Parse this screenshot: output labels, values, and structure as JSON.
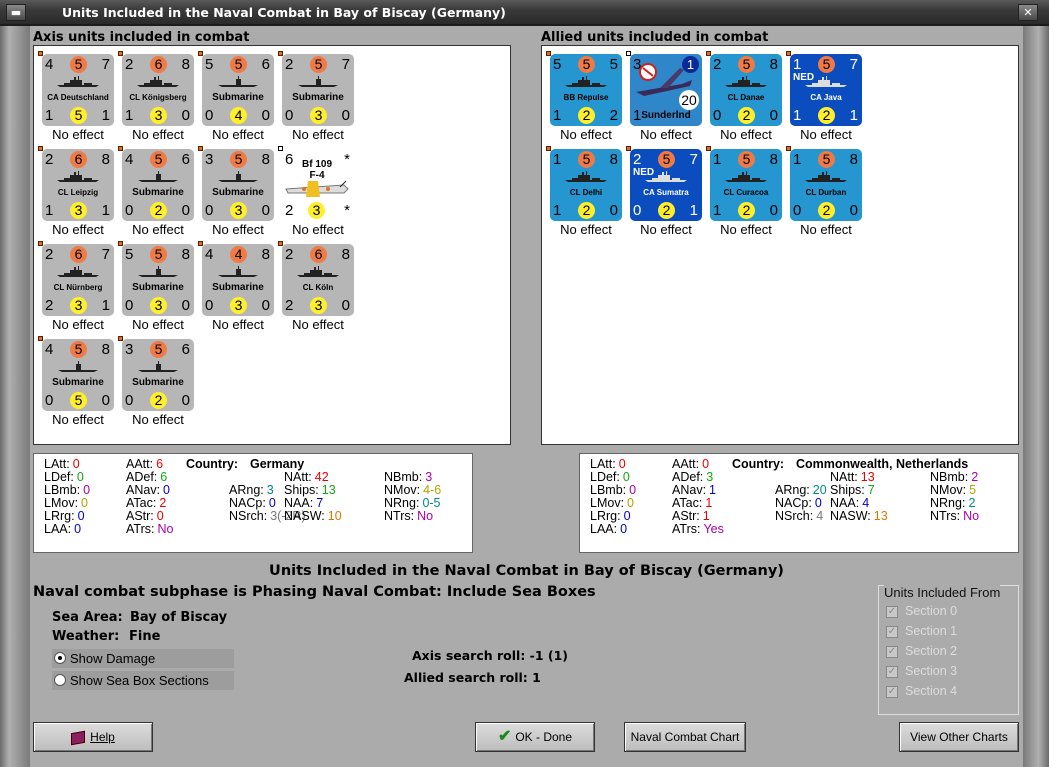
{
  "window": {
    "title": "Units Included in the Naval Combat in Bay of Biscay (Germany)"
  },
  "axis_title": "Axis units included in combat",
  "allied_title": "Allied units included in combat",
  "axis_units": [
    {
      "tl": "4",
      "tc": "5",
      "tr": "7",
      "name": "CA Deutschland",
      "bl": "1",
      "bc": "5",
      "br": "1",
      "effect": "No effect",
      "style": "grey"
    },
    {
      "tl": "2",
      "tc": "6",
      "tr": "8",
      "name": "CL Königsberg",
      "bl": "1",
      "bc": "3",
      "br": "0",
      "effect": "No effect",
      "style": "grey"
    },
    {
      "tl": "5",
      "tc": "5",
      "tr": "6",
      "name": "Submarine",
      "bl": "0",
      "bc": "4",
      "br": "0",
      "effect": "No effect",
      "style": "grey"
    },
    {
      "tl": "2",
      "tc": "5",
      "tr": "7",
      "name": "Submarine",
      "bl": "0",
      "bc": "3",
      "br": "0",
      "effect": "No effect",
      "style": "grey"
    },
    {
      "tl": "2",
      "tc": "6",
      "tr": "8",
      "name": "CL Leipzig",
      "bl": "1",
      "bc": "3",
      "br": "1",
      "effect": "No effect",
      "style": "grey"
    },
    {
      "tl": "4",
      "tc": "5",
      "tr": "6",
      "name": "Submarine",
      "bl": "0",
      "bc": "2",
      "br": "0",
      "effect": "No effect",
      "style": "grey"
    },
    {
      "tl": "3",
      "tc": "5",
      "tr": "8",
      "name": "Submarine",
      "bl": "0",
      "bc": "3",
      "br": "0",
      "effect": "No effect",
      "style": "grey"
    },
    {
      "tl": "6",
      "tc": "",
      "tr": "*",
      "name": "Bf 109 F-4",
      "bl": "2",
      "bc": "3",
      "br": "*",
      "effect": "No effect",
      "style": "white"
    },
    {
      "tl": "2",
      "tc": "6",
      "tr": "7",
      "name": "CL Nürnberg",
      "bl": "2",
      "bc": "3",
      "br": "1",
      "effect": "No effect",
      "style": "grey"
    },
    {
      "tl": "5",
      "tc": "5",
      "tr": "8",
      "name": "Submarine",
      "bl": "0",
      "bc": "3",
      "br": "0",
      "effect": "No effect",
      "style": "grey"
    },
    {
      "tl": "4",
      "tc": "4",
      "tr": "8",
      "name": "Submarine",
      "bl": "0",
      "bc": "3",
      "br": "0",
      "effect": "No effect",
      "style": "grey"
    },
    {
      "tl": "2",
      "tc": "6",
      "tr": "8",
      "name": "CL Köln",
      "bl": "2",
      "bc": "3",
      "br": "0",
      "effect": "No effect",
      "style": "grey"
    },
    {
      "tl": "4",
      "tc": "5",
      "tr": "8",
      "name": "Submarine",
      "bl": "0",
      "bc": "5",
      "br": "0",
      "effect": "No effect",
      "style": "grey"
    },
    {
      "tl": "3",
      "tc": "5",
      "tr": "6",
      "name": "Submarine",
      "bl": "0",
      "bc": "2",
      "br": "0",
      "effect": "No effect",
      "style": "grey"
    }
  ],
  "allied_units": [
    {
      "tl": "5",
      "tc": "5",
      "tr": "5",
      "name": "BB Repulse",
      "bl": "1",
      "bc": "2",
      "br": "2",
      "effect": "No effect",
      "style": "blue"
    },
    {
      "tl": "3",
      "tc": "",
      "tr": "1",
      "name": "Sunderlnd",
      "bl": "1",
      "bc": "",
      "br": "20",
      "effect": "No effect",
      "style": "plane"
    },
    {
      "tl": "2",
      "tc": "5",
      "tr": "8",
      "name": "CL Danae",
      "bl": "0",
      "bc": "2",
      "br": "0",
      "effect": "No effect",
      "style": "blue"
    },
    {
      "tl": "1",
      "tc": "5",
      "tr": "7",
      "name": "CA Java",
      "nat": "NED",
      "bl": "1",
      "bc": "2",
      "br": "1",
      "effect": "No effect",
      "style": "dblue"
    },
    {
      "tl": "1",
      "tc": "5",
      "tr": "8",
      "name": "CL Delhi",
      "bl": "1",
      "bc": "2",
      "br": "0",
      "effect": "No effect",
      "style": "blue"
    },
    {
      "tl": "2",
      "tc": "5",
      "tr": "7",
      "name": "CA Sumatra",
      "nat": "NED",
      "bl": "0",
      "bc": "2",
      "br": "1",
      "effect": "No effect",
      "style": "dblue"
    },
    {
      "tl": "1",
      "tc": "5",
      "tr": "8",
      "name": "CL Curacoa",
      "bl": "1",
      "bc": "2",
      "br": "0",
      "effect": "No effect",
      "style": "blue"
    },
    {
      "tl": "1",
      "tc": "5",
      "tr": "8",
      "name": "CL Durban",
      "bl": "0",
      "bc": "2",
      "br": "0",
      "effect": "No effect",
      "style": "blue"
    }
  ],
  "axis_stats": {
    "country_label": "Country:",
    "country": "Germany",
    "items": [
      {
        "k": "LAtt:",
        "v": "0",
        "c": "red"
      },
      {
        "k": "LDef:",
        "v": "0",
        "c": "grn"
      },
      {
        "k": "LBmb:",
        "v": "0",
        "c": "pur"
      },
      {
        "k": "LMov:",
        "v": "0",
        "c": "ylw"
      },
      {
        "k": "LRrg:",
        "v": "0",
        "c": "blu"
      },
      {
        "k": "LAA:",
        "v": "0",
        "c": "blu"
      },
      {
        "k": "AAtt:",
        "v": "6",
        "c": "red"
      },
      {
        "k": "ADef:",
        "v": "6",
        "c": "grn"
      },
      {
        "k": "ANav:",
        "v": "0",
        "c": "blu"
      },
      {
        "k": "ATac:",
        "v": "2",
        "c": "red"
      },
      {
        "k": "AStr:",
        "v": "0",
        "c": "red"
      },
      {
        "k": "ATrs:",
        "v": "No",
        "c": "pur"
      },
      {
        "k": "ARng:",
        "v": "3",
        "c": "teal"
      },
      {
        "k": "NACp:",
        "v": "0",
        "c": "blu"
      },
      {
        "k": "NSrch:",
        "v": "3(-2R)",
        "c": "gry"
      },
      {
        "k": "NAtt:",
        "v": "42",
        "c": "red"
      },
      {
        "k": "Ships:",
        "v": "13",
        "c": "grn"
      },
      {
        "k": "NAA:",
        "v": "7",
        "c": "blu"
      },
      {
        "k": "NASW:",
        "v": "10",
        "c": "org"
      },
      {
        "k": "NBmb:",
        "v": "3",
        "c": "pur"
      },
      {
        "k": "NMov:",
        "v": "4-6",
        "c": "ylw"
      },
      {
        "k": "NRng:",
        "v": "0-5",
        "c": "teal"
      },
      {
        "k": "NTrs:",
        "v": "No",
        "c": "pur"
      }
    ]
  },
  "allied_stats": {
    "country_label": "Country:",
    "country": "Commonwealth, Netherlands",
    "items": [
      {
        "k": "LAtt:",
        "v": "0",
        "c": "red"
      },
      {
        "k": "LDef:",
        "v": "0",
        "c": "grn"
      },
      {
        "k": "LBmb:",
        "v": "0",
        "c": "pur"
      },
      {
        "k": "LMov:",
        "v": "0",
        "c": "ylw"
      },
      {
        "k": "LRrg:",
        "v": "0",
        "c": "blu"
      },
      {
        "k": "LAA:",
        "v": "0",
        "c": "blu"
      },
      {
        "k": "AAtt:",
        "v": "0",
        "c": "red"
      },
      {
        "k": "ADef:",
        "v": "3",
        "c": "grn"
      },
      {
        "k": "ANav:",
        "v": "1",
        "c": "blu"
      },
      {
        "k": "ATac:",
        "v": "1",
        "c": "red"
      },
      {
        "k": "AStr:",
        "v": "1",
        "c": "red"
      },
      {
        "k": "ATrs:",
        "v": "Yes",
        "c": "pur"
      },
      {
        "k": "ARng:",
        "v": "20",
        "c": "teal"
      },
      {
        "k": "NACp:",
        "v": "0",
        "c": "blu"
      },
      {
        "k": "NSrch:",
        "v": "4",
        "c": "gry"
      },
      {
        "k": "NAtt:",
        "v": "13",
        "c": "red"
      },
      {
        "k": "Ships:",
        "v": "7",
        "c": "grn"
      },
      {
        "k": "NAA:",
        "v": "4",
        "c": "blu"
      },
      {
        "k": "NASW:",
        "v": "13",
        "c": "org"
      },
      {
        "k": "NBmb:",
        "v": "2",
        "c": "pur"
      },
      {
        "k": "NMov:",
        "v": "5",
        "c": "ylw"
      },
      {
        "k": "NRng:",
        "v": "2",
        "c": "teal"
      },
      {
        "k": "NTrs:",
        "v": "No",
        "c": "pur"
      }
    ]
  },
  "bottom": {
    "heading": "Units Included in the Naval Combat in Bay of Biscay (Germany)",
    "subphase": "Naval combat subphase is Phasing Naval Combat: Include Sea Boxes",
    "sea_area_label": "Sea Area:",
    "sea_area": "Bay of Biscay",
    "weather_label": "Weather:",
    "weather": "Fine",
    "show_damage": "Show Damage",
    "show_sea_box": "Show Sea Box Sections",
    "axis_search": "Axis search roll:  -1 (1)",
    "allied_search": "Allied search roll:  1",
    "from_title": "Units Included From",
    "sections": [
      "Section 0",
      "Section 1",
      "Section 2",
      "Section 3",
      "Section 4"
    ]
  },
  "buttons": {
    "help": "Help",
    "ok": "OK - Done",
    "chart": "Naval Combat Chart",
    "other": "View Other Charts"
  }
}
